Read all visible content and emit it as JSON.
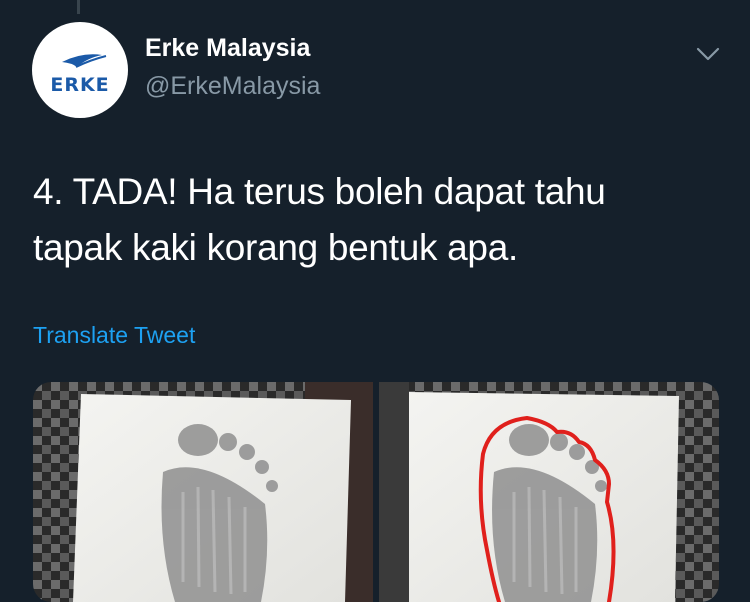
{
  "tweet": {
    "author": {
      "display_name": "Erke Malaysia",
      "handle": "@ErkeMalaysia",
      "logo_text": "ERKE"
    },
    "text_line1": "4. TADA! Ha terus boleh dapat tahu",
    "text_line2": "tapak kaki korang bentuk apa.",
    "translate_label": "Translate Tweet",
    "media": [
      {
        "description": "footprint on white paper"
      },
      {
        "description": "footprint on white paper outlined in red"
      }
    ]
  },
  "icons": {
    "more": "chevron-down-icon"
  },
  "colors": {
    "background": "#15202b",
    "text": "#ffffff",
    "secondary_text": "#8899a6",
    "link": "#1da1f2",
    "brand_blue": "#1b5aa8",
    "outline_red": "#e0201c"
  }
}
